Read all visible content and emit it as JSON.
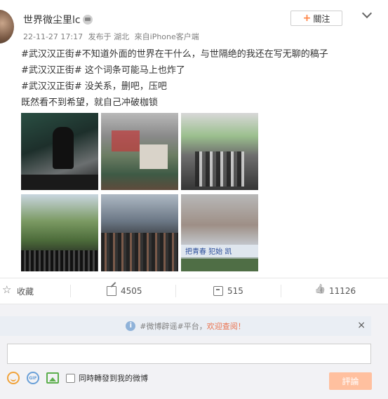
{
  "post": {
    "username": "世界微尘里lc",
    "timestamp": "22-11-27 17:17",
    "location": "发布于 湖北",
    "source": "來自iPhone客户端",
    "follow_label": "關注",
    "lines": [
      "#武汉汉正街#不知道外面的世界在干什么，与世隔绝的我还在写无聊的稿子",
      "#武汉汉正街# 这个词条可能马上也炸了",
      "#武汉汉正街# 没关系，删吧，压吧",
      "既然看不到希望，就自己冲破枷锁"
    ],
    "image_text": "把青春   犯始  凯"
  },
  "actions": {
    "favorite_label": "收藏",
    "repost_count": "4505",
    "comment_count": "515",
    "like_count": "11126"
  },
  "reply": {
    "notice_prefix": "#微博辟谣#平台，",
    "notice_link": "欢迎查阅！",
    "sync_label": "同時轉發到我的微博",
    "submit_label": "評論",
    "close_symbol": "×"
  },
  "colors": {
    "accent": "#ff8140",
    "link": "#eb7350",
    "submit_bg": "#ffc09f"
  },
  "icons": [
    "star-icon",
    "share-icon",
    "comment-icon",
    "thumb-icon",
    "info-icon",
    "emoji-icon",
    "gif-icon",
    "image-icon",
    "chevron-down-icon",
    "crown-icon"
  ]
}
